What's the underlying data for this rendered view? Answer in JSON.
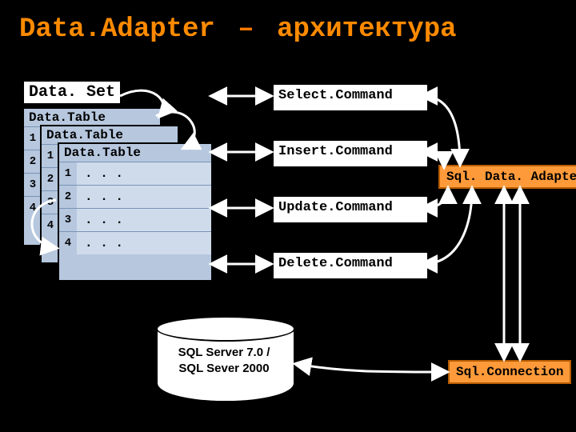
{
  "title": {
    "left": "Data.Adapter",
    "dash": "–",
    "right": "архитектура"
  },
  "dataset": {
    "label": "Data. Set",
    "tables": [
      {
        "label": "Data.Table"
      },
      {
        "label": "Data.Table"
      },
      {
        "label": "Data.Table"
      }
    ],
    "rows": [
      {
        "n": "1",
        "v": ". . ."
      },
      {
        "n": "2",
        "v": ". . ."
      },
      {
        "n": "3",
        "v": ". . ."
      },
      {
        "n": "4",
        "v": ". . ."
      }
    ]
  },
  "commands": {
    "select": "Select.Command",
    "insert": "Insert.Command",
    "update": "Update.Command",
    "delete": "Delete.Command"
  },
  "right": {
    "adapter": "Sql. Data. Adapter",
    "connection": "Sql.Connection"
  },
  "database": {
    "line1": "SQL Server 7.0 /",
    "line2": "SQL Sever 2000"
  }
}
